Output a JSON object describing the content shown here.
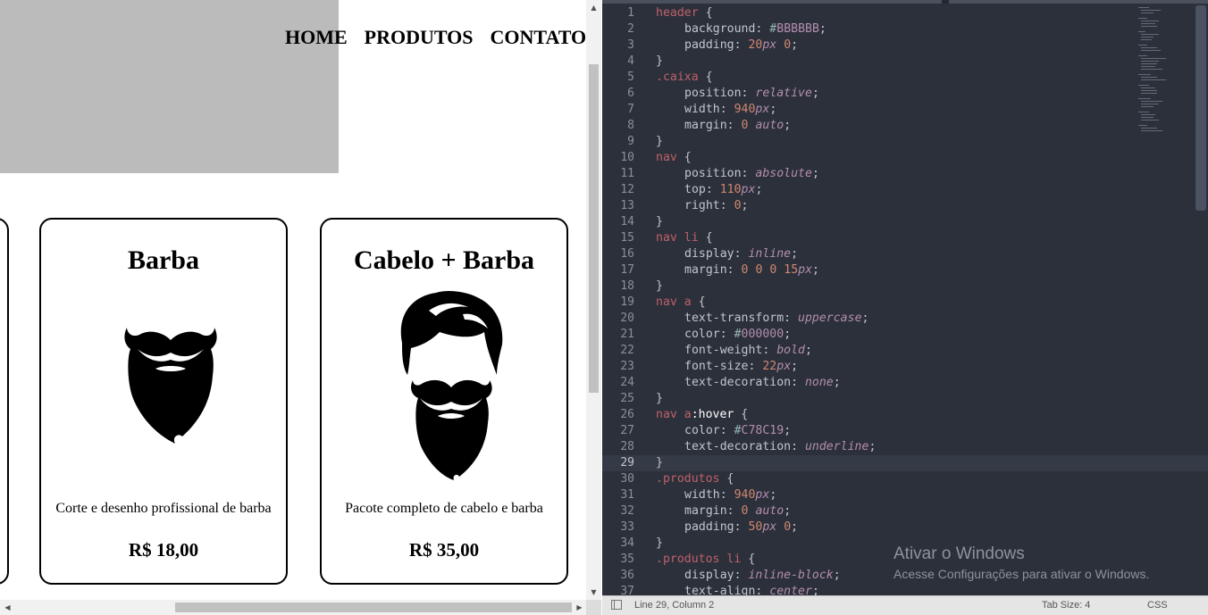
{
  "browser": {
    "nav": [
      {
        "label": "Home"
      },
      {
        "label": "Produtos"
      },
      {
        "label": "Contato"
      }
    ],
    "products": [
      {
        "title": "Barba",
        "image_icon": "beard-mustache-icon",
        "description": "Corte e desenho profissional de barba",
        "price": "R$ 18,00"
      },
      {
        "title": "Cabelo + Barba",
        "image_icon": "hair-beard-icon",
        "description": "Pacote completo de cabelo e barba",
        "price": "R$ 35,00"
      }
    ],
    "colors": {
      "header_background": "#BBBBBB"
    }
  },
  "editor": {
    "lines": [
      {
        "n": "1"
      },
      {
        "n": "2"
      },
      {
        "n": "3"
      },
      {
        "n": "4"
      },
      {
        "n": "5"
      },
      {
        "n": "6"
      },
      {
        "n": "7"
      },
      {
        "n": "8"
      },
      {
        "n": "9"
      },
      {
        "n": "10"
      },
      {
        "n": "11"
      },
      {
        "n": "12"
      },
      {
        "n": "13"
      },
      {
        "n": "14"
      },
      {
        "n": "15"
      },
      {
        "n": "16"
      },
      {
        "n": "17"
      },
      {
        "n": "18"
      },
      {
        "n": "19"
      },
      {
        "n": "20"
      },
      {
        "n": "21"
      },
      {
        "n": "22"
      },
      {
        "n": "23"
      },
      {
        "n": "24"
      },
      {
        "n": "25"
      },
      {
        "n": "26"
      },
      {
        "n": "27"
      },
      {
        "n": "28"
      },
      {
        "n": "29"
      },
      {
        "n": "30"
      },
      {
        "n": "31"
      },
      {
        "n": "32"
      },
      {
        "n": "33"
      },
      {
        "n": "34"
      },
      {
        "n": "35"
      },
      {
        "n": "36"
      },
      {
        "n": "37"
      }
    ],
    "tokens": {
      "header": "header",
      "caixa": ".caixa",
      "nav": "nav",
      "nav_li": "nav li",
      "nav_a": "nav a",
      "nav_a_sel": "nav a",
      "hover": ":hover",
      "produtos": ".produtos",
      "produtos_li": ".produtos li",
      "open": " {",
      "close": "}",
      "background": "background",
      "padding": "padding",
      "position": "position",
      "width": "width",
      "margin": "margin",
      "top": "top",
      "right": "right",
      "display": "display",
      "text_transform": "text-transform",
      "color": "color",
      "font_weight": "font-weight",
      "font_size": "font-size",
      "text_decoration": "text-decoration",
      "text_align": "text-align",
      "hash": "#",
      "bbbbbb": "BBBBBB",
      "x000000": "000000",
      "c78c19": "C78C19",
      "relative": "relative",
      "absolute": "absolute",
      "auto": "auto",
      "inline": "inline",
      "uppercase": "uppercase",
      "bold": "bold",
      "none": "none",
      "underline": "underline",
      "inline_block": "inline-block",
      "center": "center",
      "n0": "0",
      "n15": "15",
      "n20": "20",
      "n22": "22",
      "n50": "50",
      "n110": "110",
      "n940": "940",
      "px": "px",
      "colon": ": ",
      "semi": ";",
      "sp": " "
    },
    "watermark": {
      "title": "Ativar o Windows",
      "subtitle": "Acesse Configurações para ativar o Windows."
    },
    "status": {
      "position": "Line 29, Column 2",
      "tab_size": "Tab Size: 4",
      "syntax": "CSS"
    }
  }
}
